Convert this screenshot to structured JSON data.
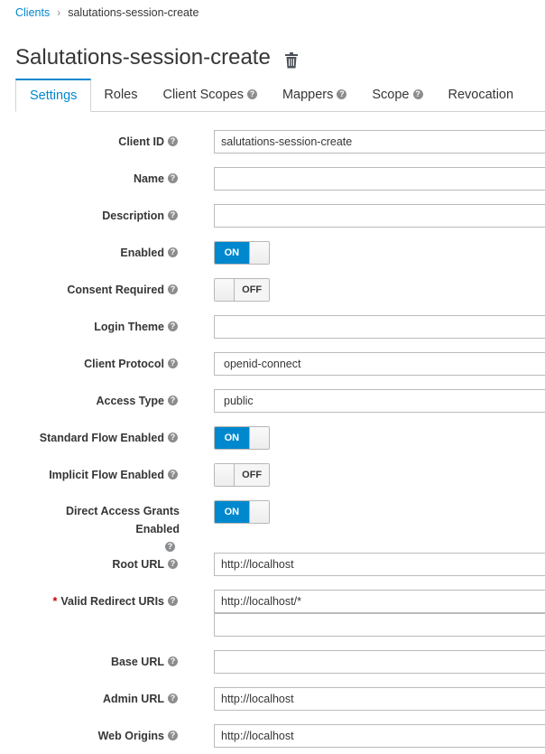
{
  "breadcrumb": {
    "clients": "Clients",
    "separator": "›",
    "current": "salutations-session-create"
  },
  "title": "Salutations-session-create",
  "tabs": [
    {
      "label": "Settings",
      "active": true,
      "help": false
    },
    {
      "label": "Roles",
      "help": false
    },
    {
      "label": "Client Scopes",
      "help": true
    },
    {
      "label": "Mappers",
      "help": true
    },
    {
      "label": "Scope",
      "help": true
    },
    {
      "label": "Revocation",
      "help": false
    }
  ],
  "help_glyph": "?",
  "fields": {
    "client_id": {
      "label": "Client ID",
      "value": "salutations-session-create"
    },
    "name": {
      "label": "Name",
      "value": ""
    },
    "description": {
      "label": "Description",
      "value": ""
    },
    "enabled": {
      "label": "Enabled",
      "state": "ON"
    },
    "consent_required": {
      "label": "Consent Required",
      "state": "OFF"
    },
    "login_theme": {
      "label": "Login Theme",
      "value": ""
    },
    "client_protocol": {
      "label": "Client Protocol",
      "value": "openid-connect"
    },
    "access_type": {
      "label": "Access Type",
      "value": "public"
    },
    "standard_flow": {
      "label": "Standard Flow Enabled",
      "state": "ON"
    },
    "implicit_flow": {
      "label": "Implicit Flow Enabled",
      "state": "OFF"
    },
    "direct_access": {
      "label": "Direct Access Grants Enabled",
      "state": "ON"
    },
    "root_url": {
      "label": "Root URL",
      "value": "http://localhost"
    },
    "valid_redirect": {
      "label": "Valid Redirect URIs",
      "required_mark": "*",
      "value": "http://localhost/*",
      "value2": ""
    },
    "base_url": {
      "label": "Base URL",
      "value": ""
    },
    "admin_url": {
      "label": "Admin URL",
      "value": "http://localhost"
    },
    "web_origins": {
      "label": "Web Origins",
      "value": "http://localhost"
    }
  },
  "colors": {
    "accent": "#0088ce",
    "required": "#cc0000",
    "help_icon": "#8b8d8f"
  }
}
